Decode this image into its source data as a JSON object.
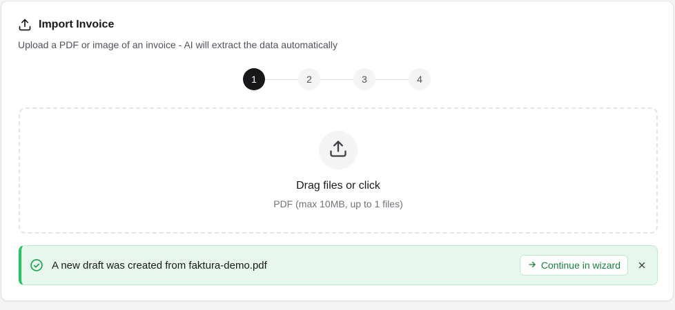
{
  "header": {
    "title": "Import Invoice",
    "subtitle": "Upload a PDF or image of an invoice - AI will extract the data automatically",
    "icon": "upload-icon"
  },
  "stepper": {
    "current": 1,
    "steps": [
      "1",
      "2",
      "3",
      "4"
    ]
  },
  "dropzone": {
    "title": "Drag files or click",
    "hint": "PDF (max 10MB, up to 1 files)",
    "icon": "upload-icon"
  },
  "alert": {
    "message": "A new draft was created from faktura-demo.pdf",
    "action_label": "Continue in wizard",
    "status": "success",
    "icon": "check-circle-icon",
    "action_icon": "arrow-right-icon",
    "close_icon": "close-icon"
  },
  "colors": {
    "accent": "#18181b",
    "success": "#22c55e",
    "success_text": "#15803d",
    "success_bg": "#e8f7ee"
  }
}
